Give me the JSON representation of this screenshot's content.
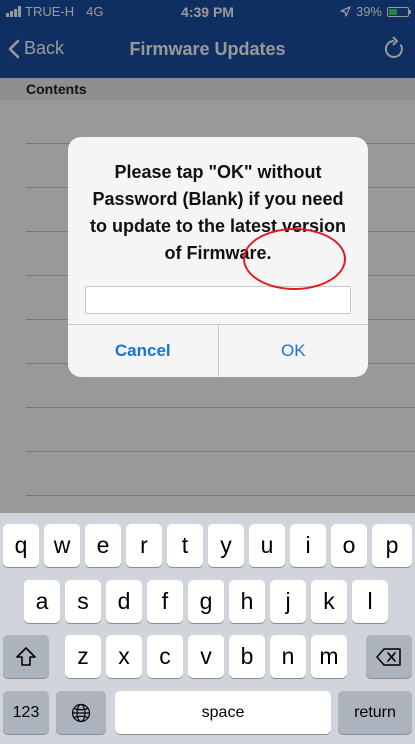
{
  "status_bar": {
    "carrier": "TRUE-H",
    "network": "4G",
    "time": "4:39 PM",
    "battery_percent": "39%",
    "battery_level": 0.39,
    "location_icon": "location-arrow-icon"
  },
  "nav_bar": {
    "back_label": "Back",
    "title": "Firmware Updates",
    "refresh_icon": "refresh-icon"
  },
  "section": {
    "header": "Contents"
  },
  "alert": {
    "message": "Please tap \"OK\" without Password (Blank) if you need to update to the latest version of Firmware.",
    "input_value": "",
    "cancel_label": "Cancel",
    "ok_label": "OK",
    "highlight_color": "#e31b23"
  },
  "keyboard": {
    "row1": [
      "q",
      "w",
      "e",
      "r",
      "t",
      "y",
      "u",
      "i",
      "o",
      "p"
    ],
    "row2": [
      "a",
      "s",
      "d",
      "f",
      "g",
      "h",
      "j",
      "k",
      "l"
    ],
    "row3": [
      "z",
      "x",
      "c",
      "v",
      "b",
      "n",
      "m"
    ],
    "numbers_label": "123",
    "space_label": "space",
    "return_label": "return"
  },
  "colors": {
    "nav_background": "#1a4ea3",
    "link_blue": "#1a73d9"
  }
}
